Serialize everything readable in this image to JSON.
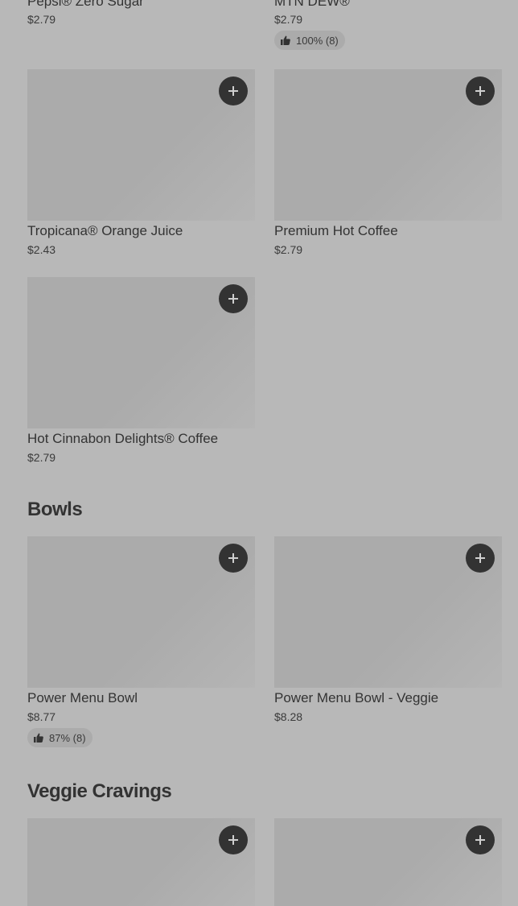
{
  "items": {
    "pepsi_zero": {
      "name": "Pepsi® Zero Sugar",
      "price": "$2.79"
    },
    "mtn_dew": {
      "name": "MTN DEW®",
      "price": "$2.79",
      "rating": "100% (8)"
    },
    "tropicana": {
      "name": "Tropicana® Orange Juice",
      "price": "$2.43"
    },
    "hot_coffee": {
      "name": "Premium Hot Coffee",
      "price": "$2.79"
    },
    "cinnabon_coffee": {
      "name": "Hot Cinnabon Delights® Coffee",
      "price": "$2.79"
    },
    "power_bowl": {
      "name": "Power Menu Bowl",
      "price": "$8.77",
      "rating": "87% (8)"
    },
    "power_bowl_veggie": {
      "name": "Power Menu Bowl - Veggie",
      "price": "$8.28"
    }
  },
  "sections": {
    "bowls": "Bowls",
    "veggie_cravings": "Veggie Cravings"
  },
  "icons": {
    "add": "plus-icon",
    "rating": "thumbs-up-icon"
  },
  "colors": {
    "background": "#b8b8b8",
    "image_placeholder": "#ababab",
    "add_button": "#333333",
    "text": "#333333"
  }
}
